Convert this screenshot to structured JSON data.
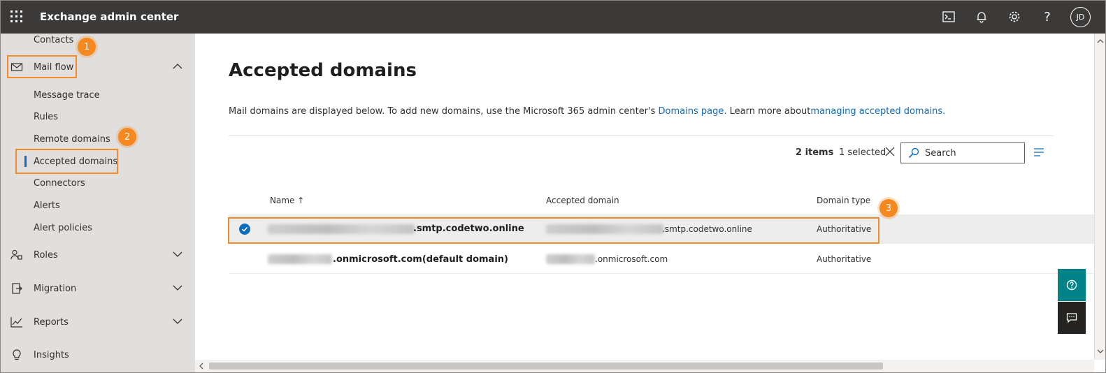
{
  "header": {
    "title": "Exchange admin center",
    "avatar_initials": "JD",
    "icons": [
      "cloud-shell-icon",
      "bell-icon",
      "gear-icon",
      "help-icon"
    ]
  },
  "sidebar": {
    "items": [
      {
        "label": "Contacts"
      },
      {
        "label": "Mail flow",
        "icon": "mail-icon",
        "expanded": true
      },
      {
        "label": "Message trace"
      },
      {
        "label": "Rules"
      },
      {
        "label": "Remote domains"
      },
      {
        "label": "Accepted domains",
        "selected": true
      },
      {
        "label": "Connectors"
      },
      {
        "label": "Alerts"
      },
      {
        "label": "Alert policies"
      },
      {
        "label": "Roles",
        "icon": "roles-icon"
      },
      {
        "label": "Migration",
        "icon": "migration-icon"
      },
      {
        "label": "Reports",
        "icon": "reports-icon"
      },
      {
        "label": "Insights",
        "icon": "insights-icon"
      }
    ]
  },
  "annotations": [
    "1",
    "2",
    "3"
  ],
  "main": {
    "title": "Accepted domains",
    "description": {
      "text1": "Mail domains are displayed below. To add new domains, use the Microsoft 365 admin center's ",
      "link1": "Domains page.",
      "text2": " Learn more about",
      "link2": "managing accepted domains."
    },
    "count": "2 items",
    "selected": "1 selected",
    "search_placeholder": "Search",
    "columns": {
      "name": "Name ↑",
      "domain": "Accepted domain",
      "type": "Domain type"
    },
    "rows": [
      {
        "name_suffix": ".smtp.codetwo.online",
        "domain_suffix": ".smtp.codetwo.online",
        "type": "Authoritative",
        "selected": true
      },
      {
        "name_suffix": ".onmicrosoft.com(default domain)",
        "domain_suffix": ".onmicrosoft.com",
        "type": "Authoritative",
        "selected": false
      }
    ]
  },
  "colors": {
    "accent": "#0f6cbd",
    "annotation": "#f28c28",
    "topbar": "#3b3a39",
    "help_teal": "#038387"
  }
}
